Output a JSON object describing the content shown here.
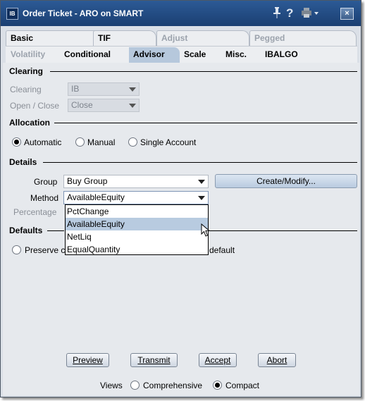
{
  "window": {
    "title": "Order Ticket - ARO on SMART",
    "close_glyph": "×"
  },
  "tabs_row1": [
    {
      "label": "Basic",
      "disabled": false
    },
    {
      "label": "TIF",
      "disabled": false
    },
    {
      "label": "Adjust",
      "disabled": true
    },
    {
      "label": "Pegged",
      "disabled": true
    }
  ],
  "tabs_row2": [
    {
      "label": "Volatility",
      "disabled": true
    },
    {
      "label": "Conditional",
      "disabled": false
    },
    {
      "label": "Advisor",
      "active": true
    },
    {
      "label": "Scale",
      "disabled": false
    },
    {
      "label": "Misc.",
      "disabled": false
    },
    {
      "label": "IBALGO",
      "disabled": false
    }
  ],
  "clearing": {
    "heading": "Clearing",
    "clearing_label": "Clearing",
    "clearing_value": "IB",
    "open_close_label": "Open / Close",
    "open_close_value": "Close"
  },
  "allocation": {
    "heading": "Allocation",
    "options": [
      "Automatic",
      "Manual",
      "Single Account"
    ],
    "selected": "Automatic"
  },
  "details": {
    "heading": "Details",
    "group_label": "Group",
    "group_value": "Buy Group",
    "create_modify_label": "Create/Modify...",
    "method_label": "Method",
    "method_value": "AvailableEquity",
    "percentage_label": "Percentage",
    "method_options": [
      "PctChange",
      "AvailableEquity",
      "NetLiq",
      "EqualQuantity"
    ],
    "method_highlighted": "AvailableEquity"
  },
  "defaults": {
    "heading": "Defaults",
    "preserve_prefix": "Preserve c",
    "preserve_suffix": "default"
  },
  "buttons": {
    "preview": "Preview",
    "transmit": "Transmit",
    "accept": "Accept",
    "abort": "Abort"
  },
  "views": {
    "label": "Views",
    "options": [
      "Comprehensive",
      "Compact"
    ],
    "selected": "Compact"
  },
  "colors": {
    "titlebar": "#1b3f72",
    "active_tab": "#b6c8dc",
    "dropdown_highlight": "#b8cbe0"
  }
}
